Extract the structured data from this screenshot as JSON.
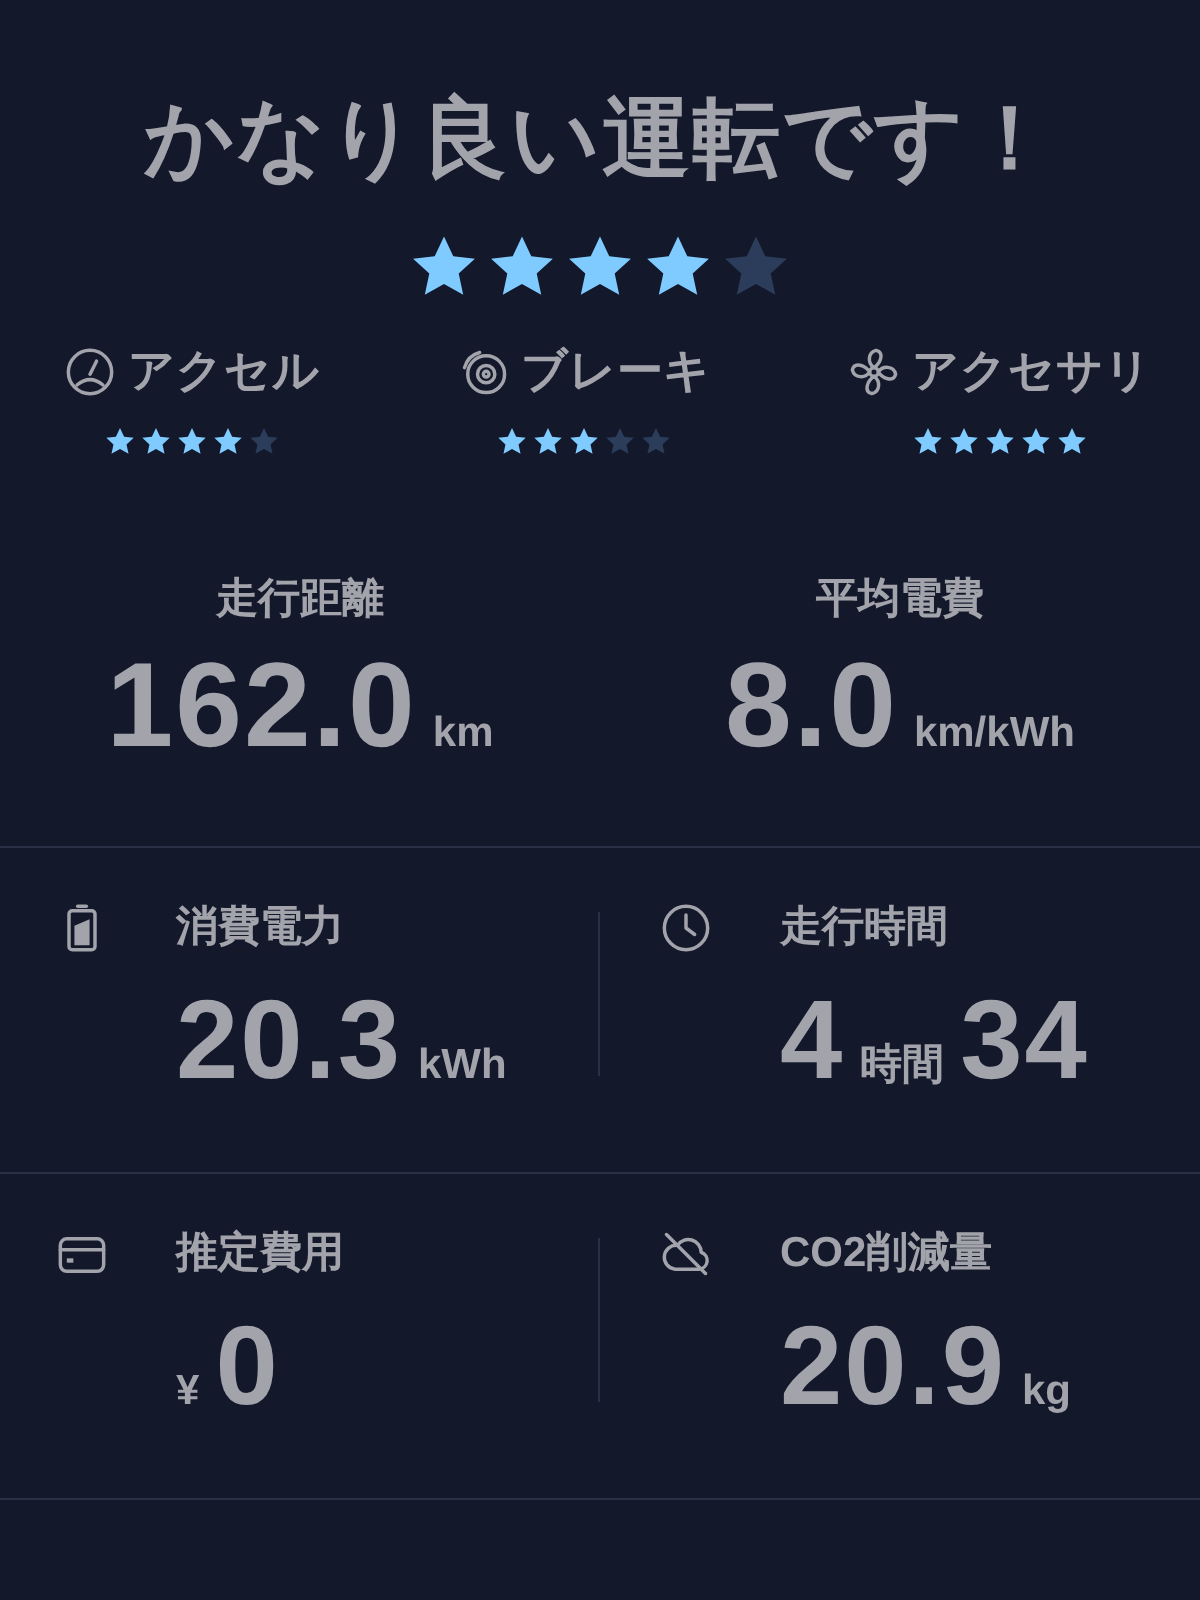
{
  "title": "かなり良い運転です！",
  "overall": {
    "stars": 4
  },
  "categories": [
    {
      "kind": "accelerator",
      "label": "アクセル",
      "stars": 4
    },
    {
      "kind": "brake",
      "label": "ブレーキ",
      "stars": 3
    },
    {
      "kind": "accessory",
      "label": "アクセサリ",
      "stars": 5
    }
  ],
  "summary": [
    {
      "label": "走行距離",
      "parts": [
        {
          "kind": "number",
          "text": "162.0"
        },
        {
          "kind": "unit",
          "text": "km"
        }
      ]
    },
    {
      "label": "平均電費",
      "parts": [
        {
          "kind": "number",
          "text": "8.0"
        },
        {
          "kind": "unit",
          "text": "km/kWh"
        }
      ]
    }
  ],
  "details": [
    {
      "kind": "battery",
      "label": "消費電力",
      "parts": [
        {
          "kind": "number",
          "text": "20.3"
        },
        {
          "kind": "unit",
          "text": "kWh"
        }
      ]
    },
    {
      "kind": "clock",
      "label": "走行時間",
      "parts": [
        {
          "kind": "number",
          "text": "4"
        },
        {
          "kind": "unit",
          "text": "時間"
        },
        {
          "kind": "number",
          "text": "34"
        }
      ]
    },
    {
      "kind": "card",
      "label": "推定費用",
      "parts": [
        {
          "kind": "unit",
          "text": "¥"
        },
        {
          "kind": "number",
          "text": "0"
        }
      ]
    },
    {
      "kind": "cloud",
      "label": "CO2削減量",
      "parts": [
        {
          "kind": "number",
          "text": "20.9"
        },
        {
          "kind": "unit",
          "text": "kg"
        }
      ]
    }
  ]
}
